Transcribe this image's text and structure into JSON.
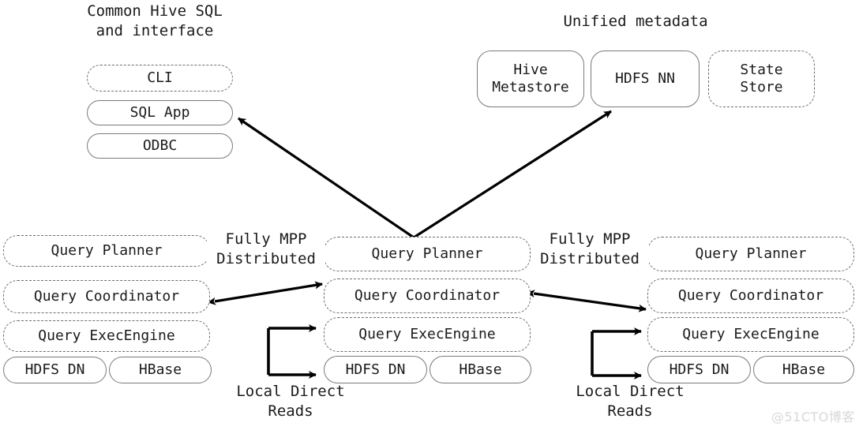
{
  "diagram": {
    "title_groups": [
      {
        "id": "common-hive-sql",
        "text": "Common Hive SQL\nand interface"
      },
      {
        "id": "unified-metadata",
        "text": "Unified metadata"
      }
    ],
    "interface_nodes": [
      {
        "id": "cli",
        "label": "CLI",
        "border": "dashed"
      },
      {
        "id": "sql-app",
        "label": "SQL App",
        "border": "solid"
      },
      {
        "id": "odbc",
        "label": "ODBC",
        "border": "solid"
      }
    ],
    "metadata_nodes": [
      {
        "id": "hive-metastore",
        "label": "Hive\nMetastore",
        "border": "solid"
      },
      {
        "id": "hdfs-nn",
        "label": "HDFS NN",
        "border": "solid"
      },
      {
        "id": "state-store",
        "label": "State\nStore",
        "border": "dashed"
      }
    ],
    "impala_nodes": [
      {
        "id": "query-planner",
        "label": "Query Planner",
        "border": "dashed"
      },
      {
        "id": "query-coordinator",
        "label": "Query Coordinator",
        "border": "dashed"
      },
      {
        "id": "query-execengine",
        "label": "Query ExecEngine",
        "border": "dashed"
      },
      {
        "id": "hdfs-dn",
        "label": "HDFS DN",
        "border": "solid"
      },
      {
        "id": "hbase",
        "label": "HBase",
        "border": "solid"
      }
    ],
    "connector_labels": [
      {
        "id": "fully-mpp-left",
        "text": "Fully MPP\nDistributed"
      },
      {
        "id": "fully-mpp-right",
        "text": "Fully MPP\nDistributed"
      }
    ],
    "local_read_labels": [
      {
        "id": "local-direct-reads-center",
        "text": "Local Direct\nReads"
      },
      {
        "id": "local-direct-reads-right",
        "text": "Local Direct\nReads"
      }
    ],
    "watermark": "@51CTO博客",
    "colors": {
      "node_border": "#7a7a7a",
      "dashed_border": "#6e6e6e",
      "text": "#1a1a1a",
      "arrow": "#000000",
      "background": "#ffffff",
      "watermark": "#d8d8d8"
    }
  }
}
